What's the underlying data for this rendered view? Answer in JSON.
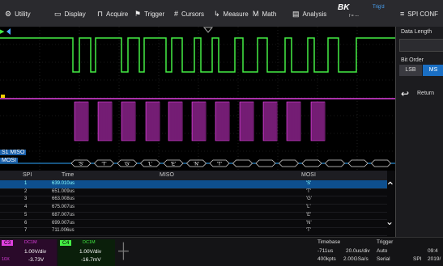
{
  "menu": {
    "items": [
      {
        "label": "Utility",
        "icon": "gear-icon"
      },
      {
        "label": "Display",
        "icon": "display-icon"
      },
      {
        "label": "Acquire",
        "icon": "acquire-icon"
      },
      {
        "label": "Trigger",
        "icon": "flag-icon"
      },
      {
        "label": "Cursors",
        "icon": "cursor-icon"
      },
      {
        "label": "Measure",
        "icon": "measure-icon"
      },
      {
        "label": "Math",
        "icon": "math-icon"
      },
      {
        "label": "Analysis",
        "icon": "analysis-icon"
      }
    ],
    "brand": "BK",
    "brand_sub": "f = ---",
    "trig_status": "Trig'd",
    "spi_conf": "SPI CONF"
  },
  "side_panel": {
    "data_length_label": "Data Length",
    "bit_order_label": "Bit Order",
    "lsb": "LSB",
    "msb": "MS",
    "return": "Return"
  },
  "wave_labels": {
    "miso": "S1 MISO",
    "mosi": "MOSI",
    "decoded_bytes": [
      "'S'",
      "'T'",
      "'G'",
      "'L'",
      "'E'",
      "'N'",
      "'T'",
      "",
      "",
      "",
      "",
      "",
      "",
      ""
    ]
  },
  "table": {
    "headers": [
      "SPI",
      "Time",
      "MISO",
      "MOSI"
    ],
    "rows": [
      {
        "idx": "1",
        "time": "639.010us",
        "miso": "",
        "mosi": "'S'"
      },
      {
        "idx": "2",
        "time": "651.009us",
        "miso": "",
        "mosi": "'T'"
      },
      {
        "idx": "3",
        "time": "663.008us",
        "miso": "",
        "mosi": "'G'"
      },
      {
        "idx": "4",
        "time": "675.007us",
        "miso": "",
        "mosi": "'L'"
      },
      {
        "idx": "5",
        "time": "687.007us",
        "miso": "",
        "mosi": "'E'"
      },
      {
        "idx": "6",
        "time": "699.007us",
        "miso": "",
        "mosi": "'N'"
      },
      {
        "idx": "7",
        "time": "711.006us",
        "miso": "",
        "mosi": "'T'"
      }
    ],
    "selected_row": 0
  },
  "bottom": {
    "c3_label": "C3",
    "c3_coupling": "DC1M",
    "c3_scale": "1.00V/div",
    "c3_offset": "-3.73V",
    "c3_probe": "10X",
    "c4_label": "C4",
    "c4_coupling": "DC1M",
    "c4_scale": "1.00V/div",
    "c4_offset": "-16.7mV",
    "timebase_label": "Timebase",
    "tb_delay": "-711us",
    "tb_scale": "20.0us/div",
    "tb_pts": "400kpts",
    "tb_rate": "2.00GSa/s",
    "trigger_label": "Trigger",
    "trig_mode": "Auto",
    "trig_type": "Serial",
    "trig_source": "SPI",
    "clock_time": "09:4",
    "clock_date": "2019/"
  },
  "colors": {
    "c3": "#e040e0",
    "c4": "#44ee44",
    "mosi_bus": "#2ea8ff",
    "accent": "#1a6fc4"
  }
}
